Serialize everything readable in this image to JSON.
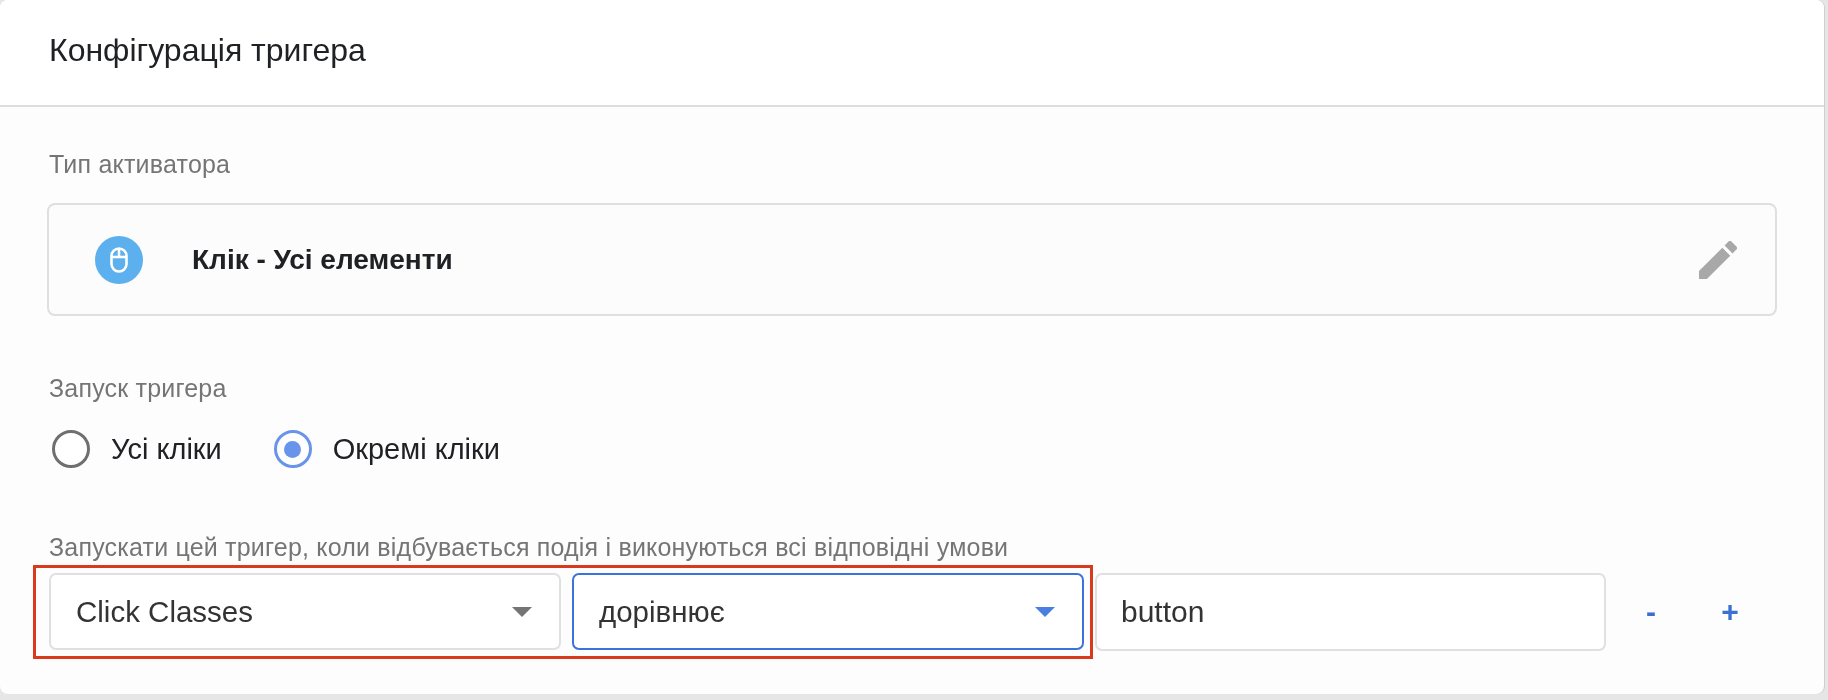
{
  "panel": {
    "title": "Конфігурація тригера"
  },
  "trigger_type": {
    "label": "Тип активатора",
    "value": "Клік - Усі елементи"
  },
  "fire_on": {
    "label": "Запуск тригера",
    "options": [
      {
        "label": "Усі кліки",
        "selected": false
      },
      {
        "label": "Окремі кліки",
        "selected": true
      }
    ]
  },
  "conditions": {
    "label": "Запускати цей тригер, коли відбувається подія і виконуються всі відповідні умови",
    "rows": [
      {
        "highlighted": true,
        "variable": {
          "value": "Click Classes",
          "focused": false
        },
        "operator": {
          "value": "дорівнює",
          "focused": true
        },
        "value": {
          "value": "button"
        },
        "remove_label": "-",
        "add_label": "+"
      }
    ]
  }
}
